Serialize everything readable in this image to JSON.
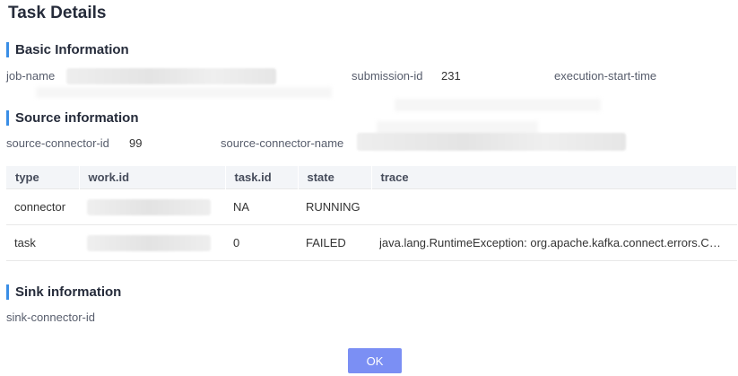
{
  "dialog": {
    "title": "Task Details",
    "ok_label": "OK"
  },
  "basic": {
    "heading": "Basic Information",
    "job_name_label": "job-name",
    "submission_id_label": "submission-id",
    "submission_id_value": "231",
    "execution_start_label": "execution-start-time"
  },
  "source": {
    "heading": "Source information",
    "connector_id_label": "source-connector-id",
    "connector_id_value": "99",
    "connector_name_label": "source-connector-name"
  },
  "table": {
    "headers": [
      "type",
      "work.id",
      "task.id",
      "state",
      "trace"
    ],
    "rows": [
      {
        "type": "connector",
        "task_id": "NA",
        "state": "RUNNING",
        "trace": ""
      },
      {
        "type": "task",
        "task_id": "0",
        "state": "FAILED",
        "trace": "java.lang.RuntimeException: org.apache.kafka.connect.errors.ConnectException"
      }
    ]
  },
  "sink": {
    "heading": "Sink information",
    "connector_id_label": "sink-connector-id"
  },
  "colors": {
    "accent": "#3a8ee6",
    "ok_button": "#7b8ff4"
  }
}
